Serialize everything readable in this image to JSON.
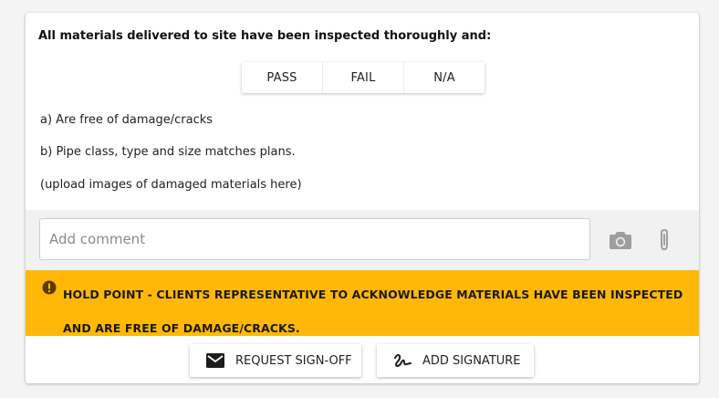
{
  "section": {
    "heading": "All materials delivered to site have been inspected thoroughly and:",
    "options": [
      "PASS",
      "FAIL",
      "N/A"
    ],
    "lines": [
      "a) Are free of damage/cracks",
      "b) Pipe class, type and size matches plans.",
      "(upload images of damaged materials here)"
    ]
  },
  "comment": {
    "placeholder": "Add comment",
    "value": "",
    "camera_icon": "camera-icon",
    "attach_icon": "paperclip-icon"
  },
  "hold_point": {
    "icon": "alert-circle-icon",
    "text": "HOLD POINT - CLIENTS REPRESENTATIVE TO ACKNOWLEDGE MATERIALS HAVE BEEN INSPECTED AND ARE FREE OF DAMAGE/CRACKS.",
    "background": "#ffb808"
  },
  "actions": {
    "request_signoff": "REQUEST SIGN-OFF",
    "add_signature": "ADD SIGNATURE"
  }
}
